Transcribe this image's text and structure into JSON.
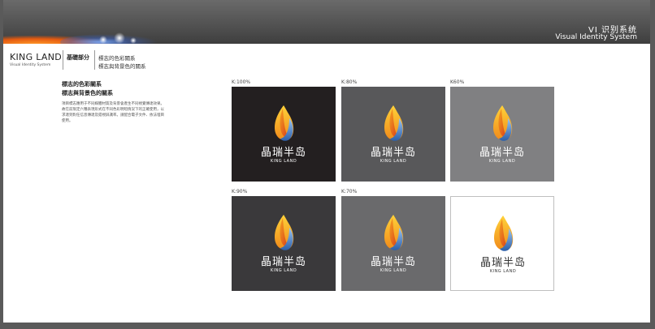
{
  "header": {
    "title_cn": "VI 识别系统",
    "title_en": "Visual Identity System"
  },
  "brand": {
    "name": "KING LAND",
    "subtitle": "Visual Identity System"
  },
  "breadcrumb": {
    "section": "基礎部分",
    "line1": "標志的色彩關系",
    "line2": "標志與背景色的關系"
  },
  "content": {
    "title1": "標志的色彩關系",
    "title2": "標志與背景色的關系",
    "description": "項目標志應用于不同媒體材質及背景會產生不同視覺傳達效果。故在前限定六種表現形式在不同色彩明暗情況下的正確使用，以求達到對任信息傳達及錯視屏識率。請配合電子文件、依法埋目使用。"
  },
  "swatches": [
    {
      "label": "K:100%",
      "cn": "晶瑞半岛",
      "en": "KING LAND",
      "bg": "#231f20",
      "light": false
    },
    {
      "label": "K:80%",
      "cn": "晶瑞半岛",
      "en": "KING LAND",
      "bg": "#58585a",
      "light": false
    },
    {
      "label": "K60%",
      "cn": "晶瑞半岛",
      "en": "KING LAND",
      "bg": "#808082",
      "light": false
    },
    {
      "label": "K:90%",
      "cn": "晶瑞半岛",
      "en": "KING LAND",
      "bg": "#3a393b",
      "light": false
    },
    {
      "label": "K:70%",
      "cn": "晶瑞半岛",
      "en": "KING LAND",
      "bg": "#6a6a6c",
      "light": false
    },
    {
      "label": "",
      "cn": "晶瑞半岛",
      "en": "KING LAND",
      "bg": "#ffffff",
      "light": true
    }
  ],
  "colors": {
    "flame_outer": "#f7a81b",
    "flame_inner": "#e8541c",
    "flame_blue": "#2f6fb7",
    "header_bg": "#4a4a4a"
  }
}
